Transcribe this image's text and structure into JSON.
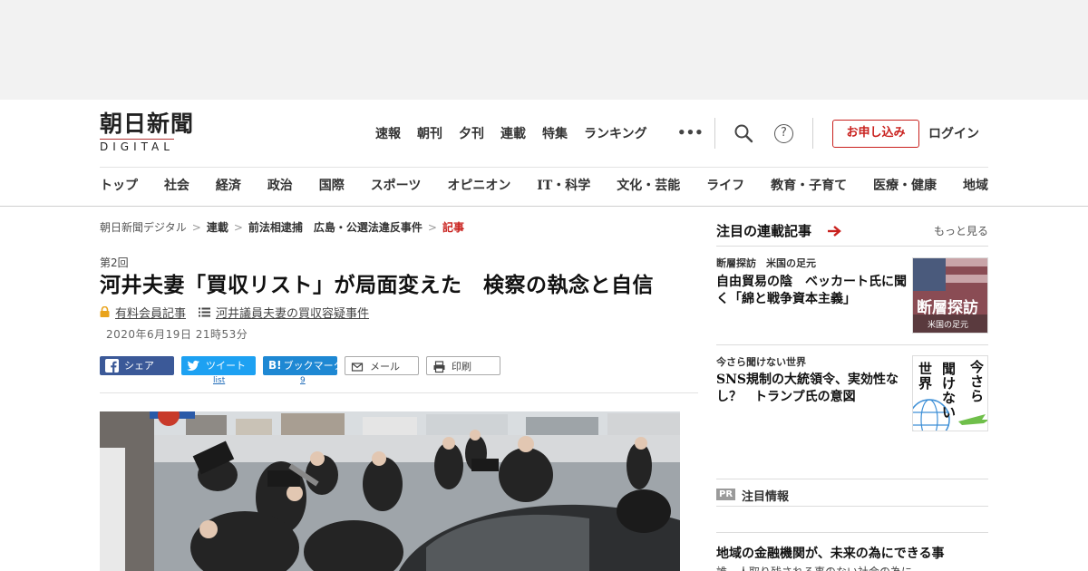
{
  "header": {
    "logo_ja": "朝日新聞",
    "logo_en": "DIGITAL",
    "topnav": [
      "速報",
      "朝刊",
      "夕刊",
      "連載",
      "特集",
      "ランキング"
    ],
    "more": "•••",
    "help": "?",
    "subscribe": "お申し込み",
    "login": "ログイン"
  },
  "catnav": [
    "トップ",
    "社会",
    "経済",
    "政治",
    "国際",
    "スポーツ",
    "オピニオン",
    "IT・科学",
    "文化・芸能",
    "ライフ",
    "教育・子育て",
    "医療・健康",
    "地域"
  ],
  "breadcrumb": {
    "items": [
      "朝日新聞デジタル",
      "連載",
      "前法相逮捕　広島・公選法違反事件"
    ],
    "sep": ">",
    "current": "記事"
  },
  "article": {
    "series_no": "第2回",
    "headline": "河井夫妻「買収リスト」が局面変えた　検察の執念と自信",
    "paid_label": "有料会員記事",
    "series_link": "河井議員夫妻の買収容疑事件",
    "date": "2020年6月19日 21時53分"
  },
  "share": {
    "fb": "シェア",
    "tw": "ツイート",
    "hb_icon": "B!",
    "hb": "ブックマーク",
    "mail": "メール",
    "print": "印刷",
    "tw_count": "list",
    "hb_count": "9"
  },
  "sidebar": {
    "title": "注目の連載記事",
    "more": "もっと見る",
    "items": [
      {
        "kicker": "断層探訪　米国の足元",
        "headline": "自由貿易の陰　ベッカート氏に聞く「綿と戦争資本主義」",
        "thumb_title": "断層探訪",
        "thumb_sub": "米国の足元"
      },
      {
        "kicker": "今さら聞けない世界",
        "headline": "SNS規制の大統領令、実効性なし？　トランプ氏の意図",
        "thumb_col1": "今さら",
        "thumb_col2": "聞けない",
        "thumb_col3": "世界"
      }
    ],
    "pr_badge": "PR",
    "pr_label": "注目情報",
    "pr_headline": "地域の金融機関が、未来の為にできる事",
    "pr_sub": "誰一人取り残される事のない社会の為に"
  },
  "colors": {
    "accent_red": "#c9211e",
    "facebook": "#3b5998",
    "twitter": "#1da1f2",
    "hatena": "#1e88d3"
  }
}
